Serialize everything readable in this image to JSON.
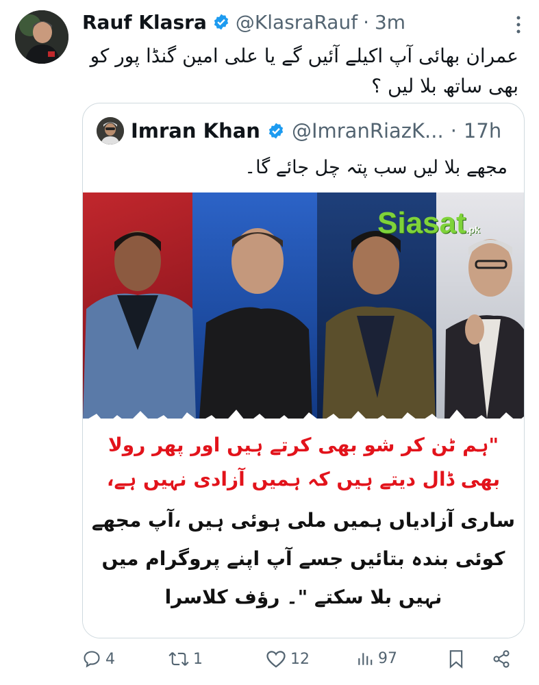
{
  "tweet": {
    "author_name": "Rauf Klasra",
    "handle": "@KlasraRauf",
    "separator": "·",
    "time": "3m",
    "text_line1": "عمران بھائی آپ اکیلے آئیں گے یا علی امین گنڈا پور کو",
    "text_line2": "بھی ساتھ بلا لیں ؟"
  },
  "quote": {
    "author_name": "Imran Khan",
    "handle": "@ImranRiazK...",
    "separator": "·",
    "time": "17h",
    "text": "مجھے بلا لیں سب پتہ چل جائے گا۔",
    "media": {
      "logo_text": "Siasat",
      "logo_suffix": ".pk",
      "caption_lines": [
        "\"ہم ٹن کر شو بھی کرتے ہیں اور پھر رولا",
        "بھی ڈال دیتے ہیں کہ ہمیں آزادی نہیں ہے،",
        "ساری آزادیاں ہمیں ملی ہوئی ہیں ،آپ مجھے",
        "کوئی بندہ بتائیں جسے آپ اپنے پروگرام میں",
        "نہیں بلا سکتے \"۔ رؤف کلاسرا"
      ]
    }
  },
  "actions": {
    "replies": "4",
    "reposts": "1",
    "likes": "12",
    "views": "97"
  },
  "colors": {
    "verified": "#1d9bf0",
    "secondary_text": "#536471",
    "caption_red": "#e2131b"
  },
  "icons": [
    "verified-badge-icon",
    "more-options-icon",
    "reply-icon",
    "repost-icon",
    "like-icon",
    "views-icon",
    "bookmark-icon",
    "share-icon"
  ]
}
